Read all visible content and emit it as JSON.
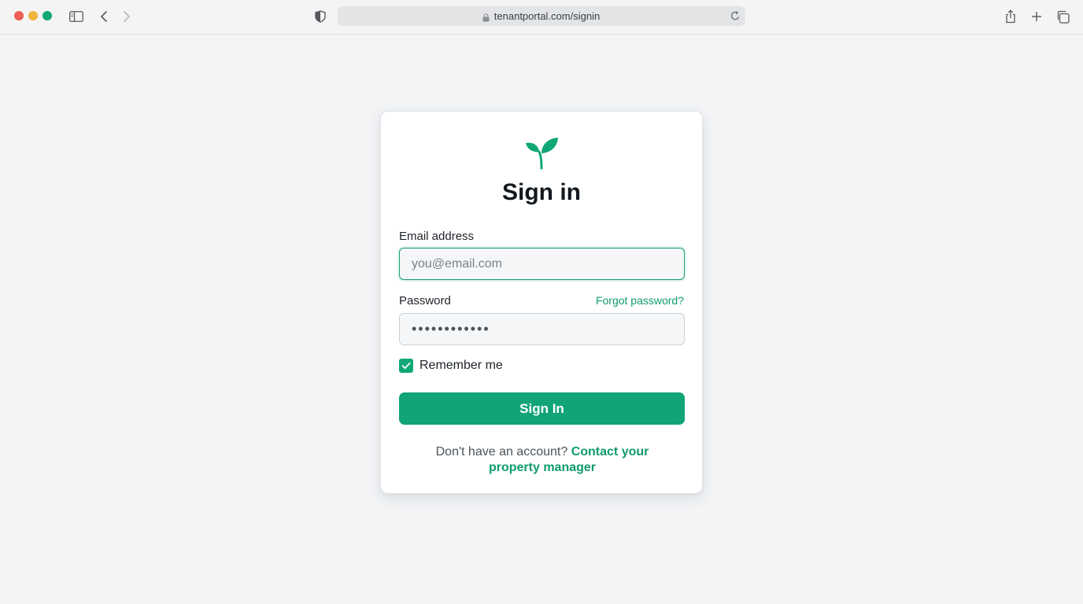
{
  "browser": {
    "url": "tenantportal.com/signin",
    "icons": [
      "sidebar-icon",
      "back-icon",
      "forward-icon",
      "shield-icon",
      "lock-icon",
      "reload-icon",
      "share-icon",
      "new-tab-icon",
      "tabs-overview-icon"
    ]
  },
  "signin": {
    "logo_icon": "sprout-icon",
    "title": "Sign in",
    "email": {
      "label": "Email address",
      "placeholder": "you@email.com",
      "value": ""
    },
    "password": {
      "label": "Password",
      "forgot_label": "Forgot password?",
      "value": "••••••••••••"
    },
    "remember": {
      "label": "Remember me",
      "checked": true
    },
    "submit_label": "Sign In",
    "footer": {
      "prompt": "Don't have an account?",
      "link_label": "Contact your property manager"
    }
  },
  "colors": {
    "accent": "#10a777",
    "link": "#0f9a6f",
    "page_background": "#f2f4f6",
    "card_background": "#ffffff"
  }
}
